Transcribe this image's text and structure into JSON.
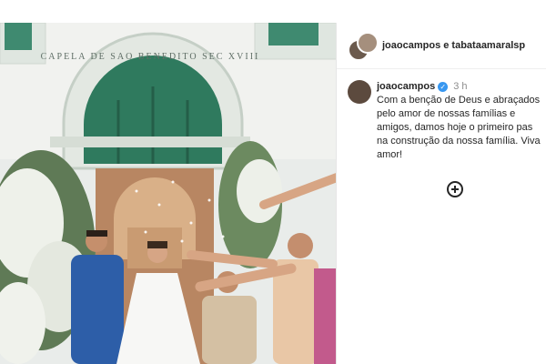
{
  "photo": {
    "facade_inscription": "CAPELA DE SAO BENEDITO SEC XVIII"
  },
  "post": {
    "header_title": "joaocampos e tabataamaralsp",
    "caption": {
      "username": "joaocampos",
      "timestamp": "3 h",
      "text": "Com a benção de Deus e abraçados\npelo amor de nossas famílias e\namigos, damos hoje o primeiro pas\nna construção da nossa família. Viva\namor!"
    },
    "icons": {
      "verified": "verified-badge-icon",
      "add": "plus-circle-icon"
    }
  }
}
